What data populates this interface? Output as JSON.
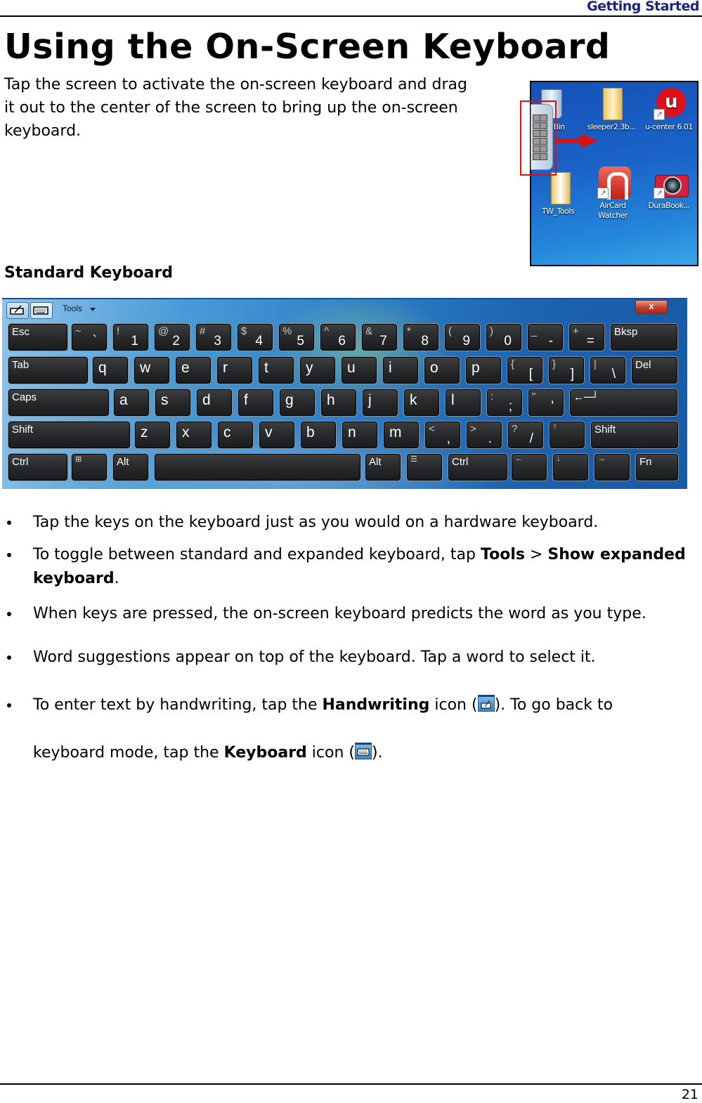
{
  "header": {
    "section_title": "Getting Started"
  },
  "page": {
    "title": "Using the On-Screen Keyboard",
    "intro": "Tap the screen to activate the on-screen keyboard and drag it out to the center of the screen to bring up the on-screen keyboard.",
    "section_heading": "Standard Keyboard",
    "page_number": "21"
  },
  "desktop_screenshot": {
    "icons": [
      {
        "label": "ycle Bin",
        "icon": "recycle-bin-icon"
      },
      {
        "label": "sleeper2.3b...",
        "icon": "folder-icon"
      },
      {
        "label": "u-center 6.01",
        "icon": "u-center-icon"
      },
      {
        "label": "TW_Tools",
        "icon": "folder-icon"
      },
      {
        "label": "AirCard Watcher",
        "icon": "aircard-watcher-icon"
      },
      {
        "label": "DuraBook...",
        "icon": "camera-icon"
      }
    ],
    "highlight_color": "#e01010"
  },
  "keyboard": {
    "toolbar": {
      "handwriting_icon": "handwriting-icon",
      "keyboard_icon": "keyboard-icon",
      "tools_label": "Tools",
      "close_label": "x"
    },
    "rows": [
      [
        {
          "label": "Esc"
        },
        {
          "shift": "~",
          "main": "`"
        },
        {
          "shift": "!",
          "main": "1"
        },
        {
          "shift": "@",
          "main": "2"
        },
        {
          "shift": "#",
          "main": "3"
        },
        {
          "shift": "$",
          "main": "4"
        },
        {
          "shift": "%",
          "main": "5"
        },
        {
          "shift": "^",
          "main": "6"
        },
        {
          "shift": "&",
          "main": "7"
        },
        {
          "shift": "*",
          "main": "8"
        },
        {
          "shift": "(",
          "main": "9"
        },
        {
          "shift": ")",
          "main": "0"
        },
        {
          "shift": "_",
          "main": "-"
        },
        {
          "shift": "+",
          "main": "="
        },
        {
          "label": "Bksp"
        }
      ],
      [
        {
          "label": "Tab"
        },
        {
          "letter": "q"
        },
        {
          "letter": "w"
        },
        {
          "letter": "e"
        },
        {
          "letter": "r"
        },
        {
          "letter": "t"
        },
        {
          "letter": "y"
        },
        {
          "letter": "u"
        },
        {
          "letter": "i"
        },
        {
          "letter": "o"
        },
        {
          "letter": "p"
        },
        {
          "shift": "{",
          "main": "["
        },
        {
          "shift": "}",
          "main": "]"
        },
        {
          "shift": "|",
          "main": "\\"
        },
        {
          "label": "Del"
        }
      ],
      [
        {
          "label": "Caps"
        },
        {
          "letter": "a"
        },
        {
          "letter": "s"
        },
        {
          "letter": "d"
        },
        {
          "letter": "f"
        },
        {
          "letter": "g"
        },
        {
          "letter": "h"
        },
        {
          "letter": "j"
        },
        {
          "letter": "k"
        },
        {
          "letter": "l"
        },
        {
          "shift": ":",
          "main": ";"
        },
        {
          "shift": "\"",
          "main": "'"
        },
        {
          "label": "←─┘"
        }
      ],
      [
        {
          "label": "Shift"
        },
        {
          "letter": "z"
        },
        {
          "letter": "x"
        },
        {
          "letter": "c"
        },
        {
          "letter": "v"
        },
        {
          "letter": "b"
        },
        {
          "letter": "n"
        },
        {
          "letter": "m"
        },
        {
          "shift": "<",
          "main": ","
        },
        {
          "shift": ">",
          "main": "."
        },
        {
          "shift": "?",
          "main": "/"
        },
        {
          "sym": "↑"
        },
        {
          "label": "Shift"
        }
      ],
      [
        {
          "label": "Ctrl"
        },
        {
          "sym": "⊞"
        },
        {
          "label": "Alt"
        },
        {
          "label": ""
        },
        {
          "label": "Alt"
        },
        {
          "sym": "☰"
        },
        {
          "label": "Ctrl"
        },
        {
          "sym": "←"
        },
        {
          "sym": "↓"
        },
        {
          "sym": "→"
        },
        {
          "label": "Fn"
        }
      ]
    ]
  },
  "bullets": [
    {
      "segments": [
        {
          "text": "Tap the keys on the keyboard just as you would on a hardware keyboard."
        }
      ]
    },
    {
      "segments": [
        {
          "text": "To toggle between standard and expanded keyboard, tap "
        },
        {
          "text": "Tools",
          "bold": true
        },
        {
          "text": " > "
        },
        {
          "text": "Show expanded keyboard",
          "bold": true
        },
        {
          "text": "."
        }
      ]
    },
    {
      "segments": [
        {
          "text": "When keys are pressed, the on-screen keyboard predicts the word as you type."
        }
      ]
    },
    {
      "segments": [
        {
          "text": "Word suggestions appear on top of the keyboard. Tap a word to select it."
        }
      ]
    },
    {
      "segments": [
        {
          "text": "To enter text by handwriting, tap the "
        },
        {
          "text": "Handwriting",
          "bold": true
        },
        {
          "text": " icon ("
        },
        {
          "icon": "handwriting-icon"
        },
        {
          "text": "). To go back to keyboard mode, tap the "
        },
        {
          "text": "Keyboard",
          "bold": true
        },
        {
          "text": " icon ("
        },
        {
          "icon": "keyboard-icon"
        },
        {
          "text": ")."
        }
      ]
    }
  ]
}
